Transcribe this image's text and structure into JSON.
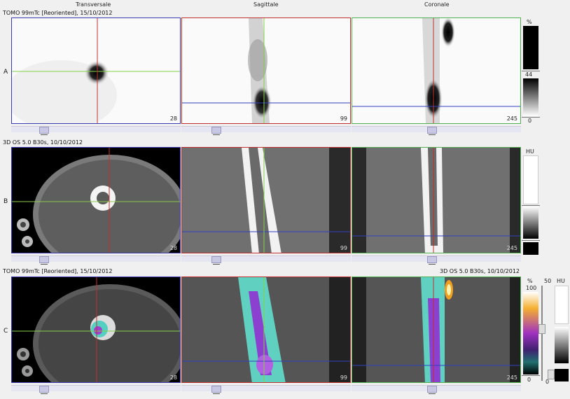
{
  "columns": {
    "transversal": "Transversale",
    "sagittal": "Sagittale",
    "coronal": "Coronale"
  },
  "rows": [
    {
      "letter": "A",
      "title": "TOMO 99mTc [Reoriented], 15/10/2012"
    },
    {
      "letter": "B",
      "title": "3D  OS  5.0  B30s, 10/10/2012"
    },
    {
      "letter": "C",
      "title": "TOMO 99mTc [Reoriented], 15/10/2012",
      "title_right": "3D  OS  5.0  B30s, 10/10/2012"
    }
  ],
  "slices": {
    "transversal": "28",
    "sagittal": "99",
    "coronal": "245"
  },
  "scales": {
    "spect": {
      "unit": "%",
      "window_top": "44",
      "window_bottom": "0"
    },
    "ct": {
      "unit": "HU"
    },
    "fused": {
      "unit_pct": "%",
      "max": "100",
      "min": "0",
      "right_top": "50",
      "right_bottom": "0",
      "unit_hu": "HU"
    }
  },
  "colors": {
    "crosshair_red": "#c03030",
    "crosshair_green": "#7fd34a",
    "crosshair_blue": "#3040c0",
    "frame_green": "#50b050",
    "frame_blue": "#3a3ab0"
  }
}
